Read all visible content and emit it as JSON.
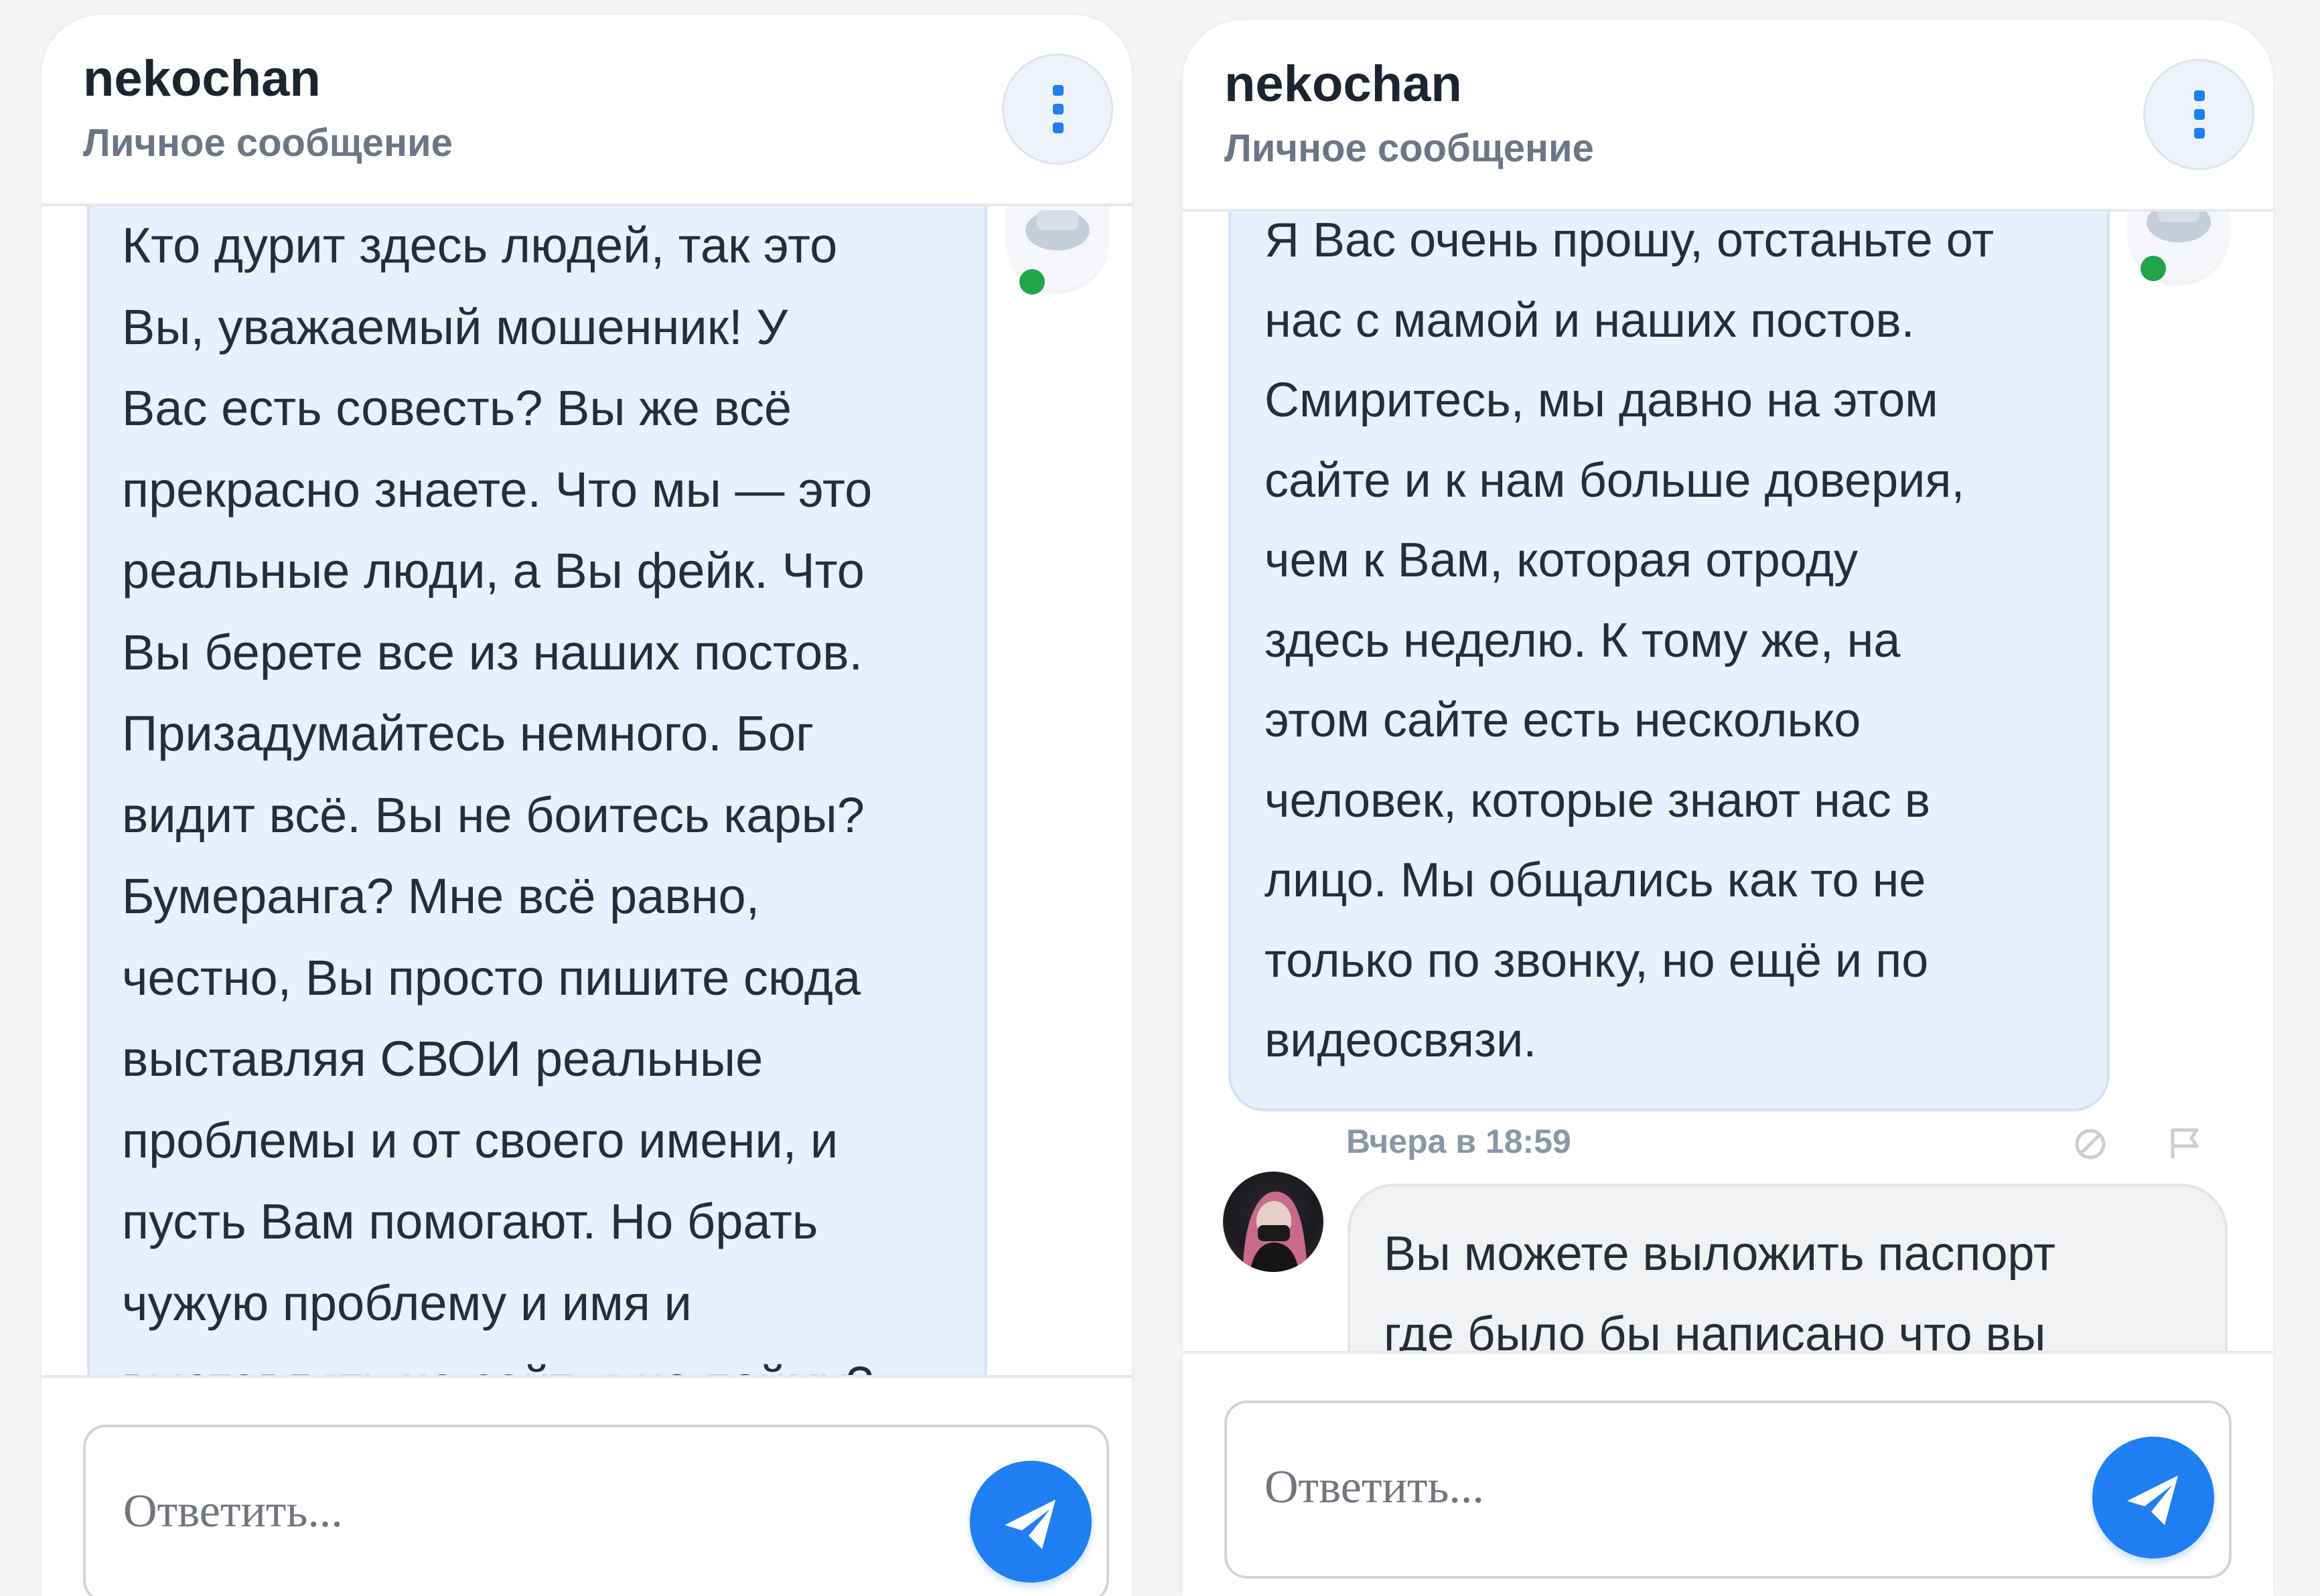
{
  "conversations": [
    {
      "header": {
        "name": "nekochan",
        "subtitle": "Личное сообщение"
      },
      "message_lines": [
        "Кто дурит здесь людей, так это",
        "Вы, уважаемый мошенник! У",
        "Вас есть совесть? Вы же всё",
        "прекрасно знаете. Что мы — это",
        "реальные люди, а Вы фейк. Что",
        "Вы берете все из наших постов.",
        "Призадумайтесь немного. Бог",
        "видит всё. Вы не боитесь кары?",
        "Бумеранга? Мне всё равно,",
        "честно, Вы просто пишите сюда",
        "выставляя СВОИ реальные",
        "проблемы и от своего имени, и",
        "пусть Вам помогают. Но брать",
        "чужую проблему и имя и",
        "выставлять на сайт, я не пойму?"
      ],
      "composer": {
        "placeholder": "Ответить..."
      }
    },
    {
      "header": {
        "name": "nekochan",
        "subtitle": "Личное сообщение"
      },
      "message_lines": [
        "Я Вас очень прошу, отстаньте от",
        "нас с мамой и наших постов.",
        "Смиритесь, мы давно на этом",
        "сайте и к нам больше доверия,",
        "чем к Вам, которая отроду",
        "здесь неделю. К тому же, на",
        "этом сайте есть несколько",
        "человек, которые знают нас в",
        "лицо. Мы общались как то не",
        "только по звонку, но ещё и по",
        "видеосвязи."
      ],
      "incoming": {
        "time": "Вчера в 18:59",
        "lines": [
          "Вы можете выложить паспорт",
          "где было бы написано что вы"
        ]
      },
      "composer": {
        "placeholder": "Ответить..."
      }
    }
  ],
  "colors": {
    "accent": "#1f7ef2",
    "online": "#22a44a",
    "bubble_bg": "#e7f0fc",
    "header_name": "#1b2430",
    "header_sub": "#6c7686"
  },
  "icons": {
    "menu": "vertical-dots-icon",
    "send": "paper-plane-icon",
    "block": "block-icon",
    "report": "flag-icon",
    "avatar": "user-avatar-icon"
  }
}
